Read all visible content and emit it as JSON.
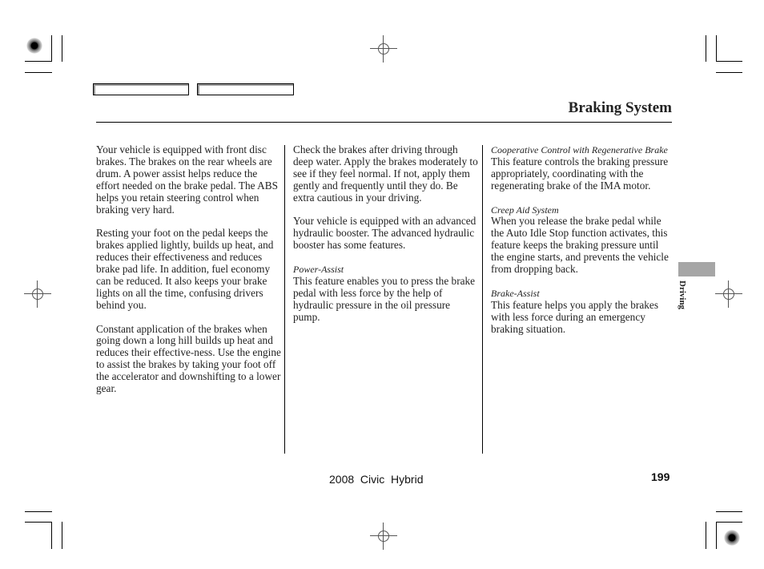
{
  "header": {
    "section_title": "Braking System",
    "tab_boxes": [
      "",
      ""
    ]
  },
  "side_tab": {
    "label": "Driving",
    "color": "#a6a6a6"
  },
  "columns": [
    {
      "paragraphs": [
        {
          "heading": "",
          "text": "Your vehicle is equipped with front disc brakes. The brakes on the rear wheels are drum. A power assist helps reduce the effort needed on the brake pedal. The ABS helps you retain steering control when braking very hard."
        },
        {
          "heading": "",
          "text": "Resting your foot on the pedal keeps the brakes applied lightly, builds up heat, and reduces their effectiveness and reduces brake pad life. In addition, fuel economy can be reduced. It also keeps your brake lights on all the time, confusing drivers behind you."
        },
        {
          "heading": "",
          "text": "Constant application of the brakes when going down a long hill builds up heat and reduces their effective-ness. Use the engine to assist the brakes by taking your foot off the accelerator and downshifting to a lower gear."
        }
      ]
    },
    {
      "paragraphs": [
        {
          "heading": "",
          "text": "Check the brakes after driving through deep water. Apply the brakes moderately to see if they feel normal. If not, apply them gently and frequently until they do. Be extra cautious in your driving."
        },
        {
          "heading": "",
          "text": "Your vehicle is equipped with an advanced hydraulic booster. The advanced hydraulic booster has some features."
        },
        {
          "heading": "Power-Assist",
          "text": "This feature enables you to press the brake pedal with less force by the help of hydraulic pressure in the oil pressure pump."
        }
      ]
    },
    {
      "paragraphs": [
        {
          "heading": "Cooperative Control with Regenerative Brake",
          "text": "This feature controls the braking pressure appropriately, coordinating with the regenerating brake of the IMA motor."
        },
        {
          "heading": "Creep Aid System",
          "text": "When you release the brake pedal while the Auto Idle Stop function activates, this feature keeps the braking pressure until the engine starts, and prevents the vehicle from dropping back."
        },
        {
          "heading": "Brake-Assist",
          "text": "This feature helps you apply the brakes with less force during an emergency braking situation."
        }
      ]
    }
  ],
  "footer": {
    "book_title": "2008  Civic  Hybrid",
    "page_number": "199"
  }
}
